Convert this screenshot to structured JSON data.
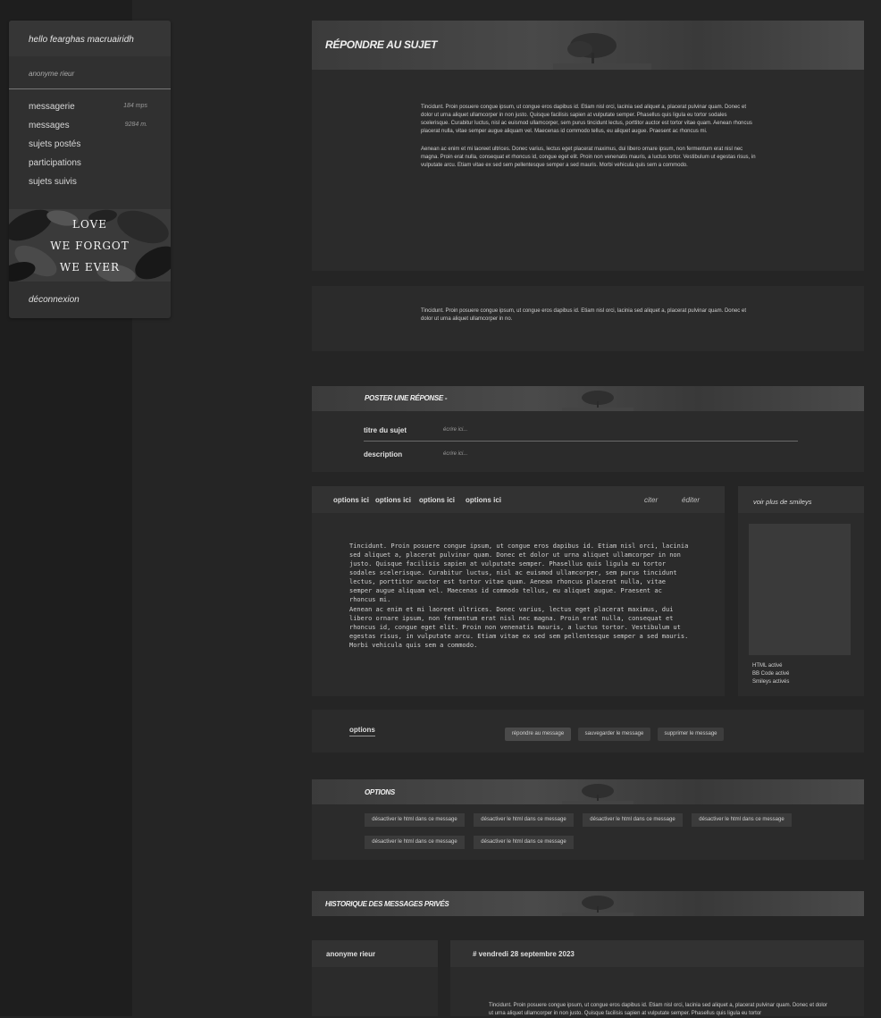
{
  "sidebar": {
    "greeting": "hello fearghas macruairidh",
    "subtitle": "anonyme rieur",
    "items": [
      {
        "label": "messagerie",
        "count": "184 mps"
      },
      {
        "label": "messages",
        "count": "9284 m."
      },
      {
        "label": "sujets postés",
        "count": ""
      },
      {
        "label": "participations",
        "count": ""
      },
      {
        "label": "sujets suivis",
        "count": ""
      }
    ],
    "banner_lines": [
      "LOVE",
      "WE FORGOT",
      "WE EVER"
    ],
    "logout": "déconnexion"
  },
  "reply": {
    "title": "RÉPONDRE AU SUJET",
    "text1": "Tincidunt. Proin posuere congue ipsum, ut congue eros dapibus id. Etiam nisl orci, lacinia sed aliquet a, placerat pulvinar quam. Donec et dolor ut urna aliquet ullamcorper in non justo. Quisque facilisis sapien at vulputate semper. Phasellus quis ligula eu tortor sodales scelerisque. Curabitur luctus, nisl ac euismod ullamcorper, sem purus tincidunt lectus, porttitor auctor est tortor vitae quam. Aenean rhoncus placerat nulla, vitae semper augue aliquam vel. Maecenas id commodo tellus, eu aliquet augue. Praesent ac rhoncus mi.",
    "text2": "Aenean ac enim et mi laoreet ultrices. Donec varius, lectus eget placerat maximus, dui libero ornare ipsum, non fermentum erat nisl nec magna. Proin erat nulla, consequat et rhoncus id, congue eget elit. Proin non venenatis mauris, a luctus tortor. Vestibulum ut egestas risus, in vulputate arcu. Etiam vitae ex sed sem pellentesque semper a sed mauris. Morbi vehicula quis sem a commodo."
  },
  "notice": {
    "text": "Tincidunt. Proin posuere congue ipsum, ut congue eros dapibus id. Etiam nisl orci, lacinia sed aliquet a, placerat pulvinar quam. Donec et dolor ut urna aliquet ullamcorper in no."
  },
  "post": {
    "title": "POSTER UNE RÉPONSE -",
    "subject_label": "titre du sujet",
    "subject_placeholder": "écrire ici...",
    "description_label": "description",
    "description_placeholder": "écrire ici..."
  },
  "editor": {
    "options": [
      "options ici",
      "options ici",
      "options ici",
      "options ici"
    ],
    "quote": "citer",
    "edit": "éditer",
    "body1": "Tincidunt. Proin posuere congue ipsum, ut congue eros dapibus id. Etiam nisl orci, lacinia sed aliquet a, placerat pulvinar quam. Donec et dolor ut urna aliquet ullamcorper in non justo. Quisque facilisis sapien at vulputate semper. Phasellus quis ligula eu tortor sodales scelerisque. Curabitur luctus, nisl ac euismod ullamcorper, sem purus tincidunt lectus, porttitor auctor est tortor vitae quam. Aenean rhoncus placerat nulla, vitae semper augue aliquam vel. Maecenas id commodo tellus, eu aliquet augue. Praesent ac rhoncus mi.",
    "body2": "Aenean ac enim et mi laoreet ultrices. Donec varius, lectus eget placerat maximus, dui libero ornare ipsum, non fermentum erat nisl nec magna. Proin erat nulla, consequat et rhoncus id, congue eget elit. Proin non venenatis mauris, a luctus tortor. Vestibulum ut egestas risus, in vulputate arcu. Etiam vitae ex sed sem pellentesque semper a sed mauris. Morbi vehicula quis sem a commodo."
  },
  "smileys": {
    "more": "voir plus de smileys",
    "status": [
      "HTML activé",
      "BB Code activé",
      "Smileys activés"
    ]
  },
  "actions": {
    "options_label": "options",
    "reply": "répondre au message",
    "save": "sauvegarder le message",
    "delete": "supprimer le message"
  },
  "options_section": {
    "title": "OPTIONS",
    "chips": [
      "désactiver le html dans ce message",
      "désactiver le html dans ce message",
      "désactiver le html dans ce message",
      "désactiver le html dans ce message",
      "désactiver le html dans ce message",
      "désactiver le html dans ce message"
    ]
  },
  "history": {
    "title": "HISTORIQUE DES MESSAGES PRIVÉS",
    "author": "anonyme rieur",
    "date": "# vendredi 28 septembre 2023",
    "text": "Tincidunt. Proin posuere congue ipsum, ut congue eros dapibus id. Etiam nisl orci, lacinia sed aliquet a, placerat pulvinar quam. Donec et dolor ut urna aliquet ullamcorper in non justo. Quisque facilisis sapien at vulputate semper. Phasellus quis ligula eu tortor"
  }
}
